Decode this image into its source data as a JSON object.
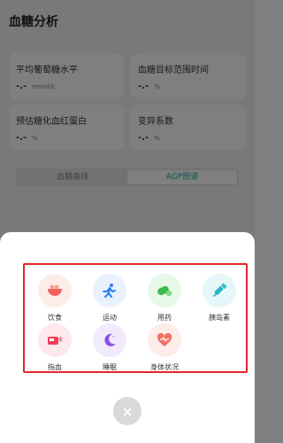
{
  "page": {
    "title": "血糖分析",
    "stats": [
      {
        "label": "平均葡萄糖水平",
        "value": "-.-",
        "unit": "mmol/L"
      },
      {
        "label": "血糖目标范围时间",
        "value": "-.-",
        "unit": "%"
      },
      {
        "label": "预估糖化血红蛋白",
        "value": "-.-",
        "unit": "%"
      },
      {
        "label": "变异系数",
        "value": "-.-",
        "unit": "%"
      }
    ],
    "tabs": [
      {
        "label": "血糖曲线",
        "active": false
      },
      {
        "label": "AGP图谱",
        "active": true
      }
    ]
  },
  "sheet": {
    "items": [
      {
        "label": "饮食",
        "icon": "food-bowl-icon",
        "bg": "#fdecea",
        "color": "#f0625a"
      },
      {
        "label": "运动",
        "icon": "running-icon",
        "bg": "#e8f1fd",
        "color": "#2f7df0"
      },
      {
        "label": "用药",
        "icon": "pill-icon",
        "bg": "#e6f8e6",
        "color": "#3dbb4a"
      },
      {
        "label": "胰岛素",
        "icon": "syringe-icon",
        "bg": "#e5f7f8",
        "color": "#20b8c4"
      },
      {
        "label": "指血",
        "icon": "blood-meter-icon",
        "bg": "#fde9ec",
        "color": "#ee4058"
      },
      {
        "label": "睡眠",
        "icon": "moon-icon",
        "bg": "#f1eafb",
        "color": "#8a4fe0"
      },
      {
        "label": "身体状况",
        "icon": "heart-icon",
        "bg": "#fdecea",
        "color": "#f2705f"
      }
    ],
    "close_icon": "close-icon"
  }
}
